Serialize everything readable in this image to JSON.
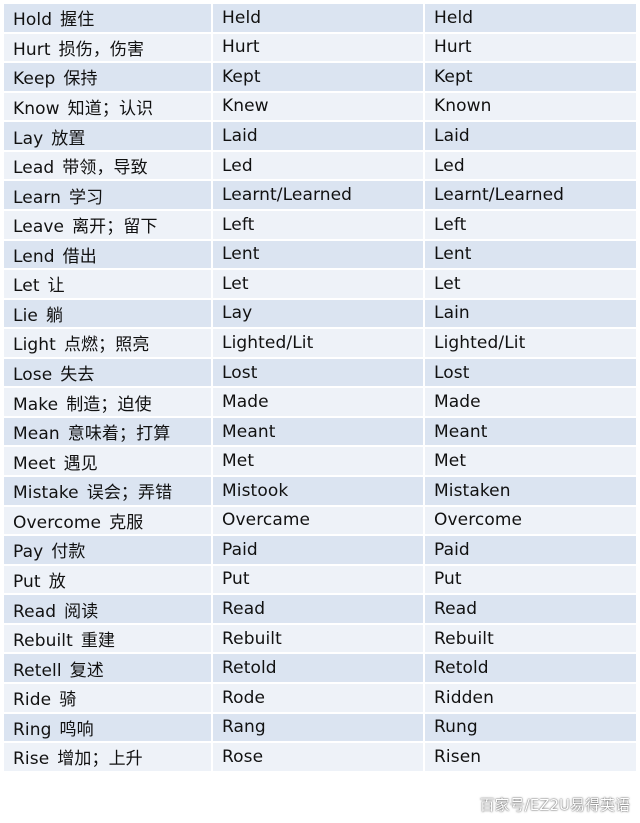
{
  "rows": [
    {
      "base": "Hold",
      "meaning": "握住",
      "past": "Held",
      "participle": "Held"
    },
    {
      "base": "Hurt",
      "meaning": "损伤，伤害",
      "past": "Hurt",
      "participle": "Hurt"
    },
    {
      "base": "Keep",
      "meaning": "保持",
      "past": "Kept",
      "participle": "Kept"
    },
    {
      "base": "Know",
      "meaning": "知道；认识",
      "past": "Knew",
      "participle": "Known"
    },
    {
      "base": "Lay",
      "meaning": "放置",
      "past": "Laid",
      "participle": "Laid"
    },
    {
      "base": "Lead",
      "meaning": "带领，导致",
      "past": "Led",
      "participle": "Led"
    },
    {
      "base": "Learn",
      "meaning": "学习",
      "past": "Learnt/Learned",
      "participle": "Learnt/Learned"
    },
    {
      "base": "Leave",
      "meaning": "离开；留下",
      "past": "Left",
      "participle": "Left"
    },
    {
      "base": "Lend",
      "meaning": "借出",
      "past": "Lent",
      "participle": "Lent"
    },
    {
      "base": "Let",
      "meaning": "让",
      "past": "Let",
      "participle": "Let"
    },
    {
      "base": "Lie",
      "meaning": "躺",
      "past": "Lay",
      "participle": "Lain"
    },
    {
      "base": "Light",
      "meaning": "点燃；照亮",
      "past": "Lighted/Lit",
      "participle": "Lighted/Lit"
    },
    {
      "base": "Lose",
      "meaning": "失去",
      "past": "Lost",
      "participle": "Lost"
    },
    {
      "base": "Make",
      "meaning": "制造；迫使",
      "past": "Made",
      "participle": "Made"
    },
    {
      "base": "Mean",
      "meaning": "意味着；打算",
      "past": "Meant",
      "participle": "Meant"
    },
    {
      "base": "Meet",
      "meaning": "遇见",
      "past": "Met",
      "participle": "Met"
    },
    {
      "base": "Mistake",
      "meaning": "误会；弄错",
      "past": "Mistook",
      "participle": "Mistaken"
    },
    {
      "base": "Overcome",
      "meaning": "克服",
      "past": "Overcame",
      "participle": "Overcome"
    },
    {
      "base": "Pay",
      "meaning": "付款",
      "past": "Paid",
      "participle": "Paid"
    },
    {
      "base": "Put",
      "meaning": "放",
      "past": "Put",
      "participle": "Put"
    },
    {
      "base": "Read",
      "meaning": "阅读",
      "past": "Read",
      "participle": "Read"
    },
    {
      "base": "Rebuilt",
      "meaning": "重建",
      "past": "Rebuilt",
      "participle": "Rebuilt"
    },
    {
      "base": "Retell",
      "meaning": "复述",
      "past": "Retold",
      "participle": "Retold"
    },
    {
      "base": "Ride",
      "meaning": "骑",
      "past": "Rode",
      "participle": "Ridden"
    },
    {
      "base": "Ring",
      "meaning": "鸣响",
      "past": "Rang",
      "participle": "Rung"
    },
    {
      "base": "Rise",
      "meaning": "增加；上升",
      "past": "Rose",
      "participle": "Risen"
    }
  ],
  "watermark": "百家号/EZ2U易得英语",
  "colors": {
    "row_odd": "#dbe4f1",
    "row_even": "#eef2f8",
    "text": "#111111"
  }
}
